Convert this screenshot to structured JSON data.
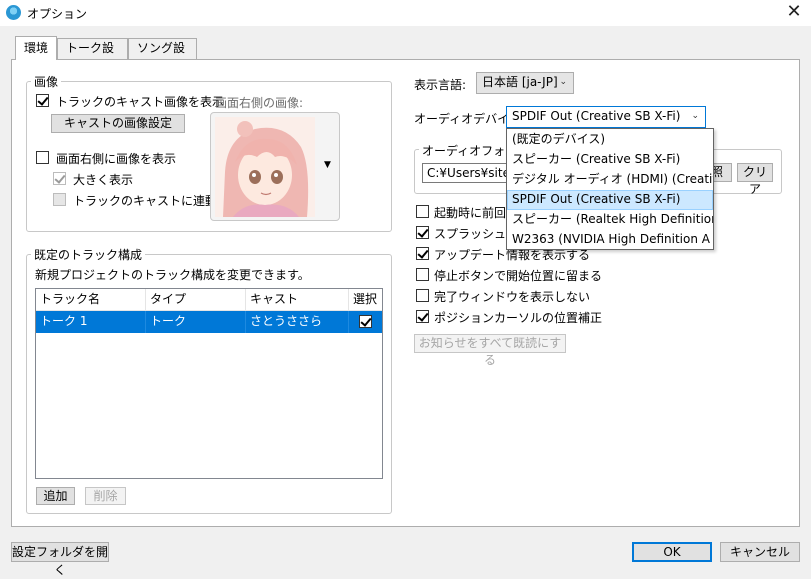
{
  "window": {
    "title": "オプション",
    "close_glyph": "✕"
  },
  "tabs": [
    "環境",
    "トーク設定",
    "ソング設定"
  ],
  "image_group": {
    "title": "画像",
    "show_cast_image": {
      "label": "トラックのキャスト画像を表示",
      "checked": true
    },
    "cast_image_settings_button": "キャストの画像設定",
    "right_image_label": "画面右側の画像:",
    "show_right_image": {
      "label": "画面右側に画像を表示",
      "checked": false
    },
    "enlarge": {
      "label": "大きく表示",
      "checked": true,
      "disabled": true
    },
    "link_track_cast": {
      "label": "トラックのキャストに連動",
      "checked": false,
      "disabled": true
    },
    "image_dropdown_glyph": "▼"
  },
  "track_group": {
    "title": "既定のトラック構成",
    "description": "新規プロジェクトのトラック構成を変更できます。",
    "columns": [
      "トラック名",
      "タイプ",
      "キャスト",
      "選択"
    ],
    "rows": [
      {
        "name": "トーク 1",
        "type": "トーク",
        "cast": "さとうささら",
        "selected": true
      }
    ],
    "add_button": "追加",
    "delete_button": "削除"
  },
  "settings": {
    "language_label": "表示言語:",
    "language_value": "日本語 [ja-JP]",
    "audio_device_label": "オーディオデバイス:",
    "audio_device_value": "SPDIF Out (Creative SB X-Fi)",
    "audio_folder_title": "オーディオフォルダ",
    "audio_folder_path": "C:¥Users¥sites¥",
    "browse_button": "照",
    "clear_button": "クリア",
    "dropdown_glyph": "⌄",
    "options": [
      {
        "label": "起動時に前回の",
        "checked": false
      },
      {
        "label": "スプラッシュ画面",
        "checked": true
      },
      {
        "label": "アップデート情報を表示する",
        "checked": true
      },
      {
        "label": "停止ボタンで開始位置に留まる",
        "checked": false
      },
      {
        "label": "完了ウィンドウを表示しない",
        "checked": false
      },
      {
        "label": "ポジションカーソルの位置補正",
        "checked": true
      }
    ],
    "mark_all_read_button": "お知らせをすべて既読にする"
  },
  "audio_device_options": [
    "(既定のデバイス)",
    "スピーカー (Creative SB X-Fi)",
    "デジタル オーディオ (HDMI) (Creative SB",
    "SPDIF Out (Creative SB X-Fi)",
    "スピーカー (Realtek High Definition",
    "W2363 (NVIDIA High Definition A"
  ],
  "audio_device_hover_index": 3,
  "footer": {
    "open_settings_folder": "設定フォルダを開く",
    "ok": "OK",
    "cancel": "キャンセル"
  }
}
